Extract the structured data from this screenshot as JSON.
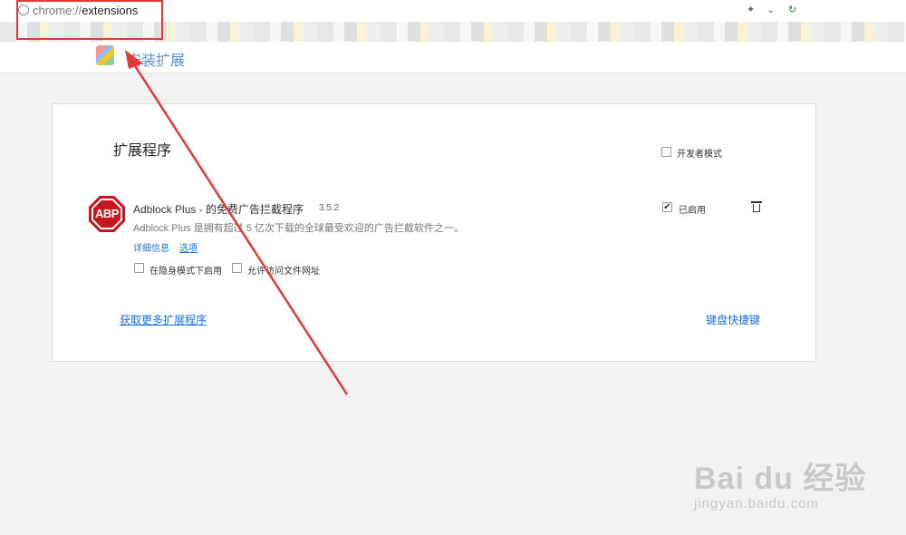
{
  "browser": {
    "url_scheme": "chrome://",
    "url_path": "extensions"
  },
  "header": {
    "title": "安装扩展"
  },
  "extensions_page": {
    "title": "扩展程序",
    "developer_mode_label": "开发者模式",
    "extension": {
      "name": "Adblock Plus - 的免费广告拦截程序",
      "version": "3.5.2",
      "description": "Adblock Plus 是拥有超过 5 亿次下载的全球最受欢迎的广告拦截软件之一。",
      "details_link": "详细信息",
      "options_link": "选项",
      "enabled_label": "已启用",
      "enabled": true,
      "incognito_label": "在隐身模式下启用",
      "file_access_label": "允许访问文件网址",
      "icon_text": "ABP"
    },
    "get_more_link": "获取更多扩展程序",
    "keyboard_shortcuts_link": "键盘快捷键"
  },
  "watermark": {
    "main": "Bai du 经验",
    "sub": "jingyan.baidu.com"
  },
  "colors": {
    "annotation": "#e53935",
    "link": "#1a73e8",
    "abp_red": "#c8161d"
  }
}
